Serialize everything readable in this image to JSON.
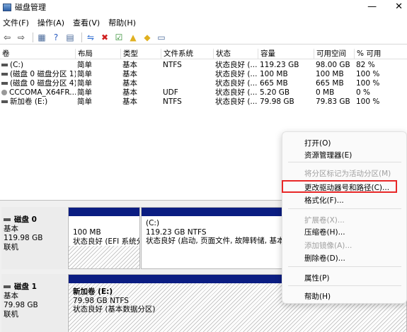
{
  "window": {
    "title": "磁盘管理",
    "minimize": "—",
    "close": "✕"
  },
  "menu": [
    "文件(F)",
    "操作(A)",
    "查看(V)",
    "帮助(H)"
  ],
  "toolbar": [
    {
      "name": "back-icon",
      "glyph": "⇦",
      "color": "#333333"
    },
    {
      "name": "forward-icon",
      "glyph": "⇨",
      "color": "#333333"
    },
    {
      "name": "sep"
    },
    {
      "name": "properties-icon",
      "glyph": "▦",
      "color": "#4a6a9a"
    },
    {
      "name": "help-icon",
      "glyph": "?",
      "color": "#2a5cc0"
    },
    {
      "name": "refresh-list-icon",
      "glyph": "▤",
      "color": "#4a6a9a"
    },
    {
      "name": "sep"
    },
    {
      "name": "connect-icon",
      "glyph": "⇋",
      "color": "#2a6ad0"
    },
    {
      "name": "delete-icon",
      "glyph": "✖",
      "color": "#d02020"
    },
    {
      "name": "check-icon",
      "glyph": "☑",
      "color": "#2a8a2a"
    },
    {
      "name": "folder-up-icon",
      "glyph": "▲",
      "color": "#e0b020"
    },
    {
      "name": "folder-find-icon",
      "glyph": "◆",
      "color": "#e0b020"
    },
    {
      "name": "view-icon",
      "glyph": "▭",
      "color": "#4a6a9a"
    }
  ],
  "volume_table": {
    "headers": [
      "卷",
      "布局",
      "类型",
      "文件系统",
      "状态",
      "容量",
      "可用空间",
      "% 可用"
    ],
    "rows": [
      {
        "icon": "volume-icon",
        "cells": [
          "(C:)",
          "简单",
          "基本",
          "NTFS",
          "状态良好 (...",
          "119.23 GB",
          "98.00 GB",
          "82 %"
        ]
      },
      {
        "icon": "volume-icon",
        "cells": [
          "(磁盘 0 磁盘分区 1)",
          "简单",
          "基本",
          "",
          "状态良好 (...",
          "100 MB",
          "100 MB",
          "100 %"
        ]
      },
      {
        "icon": "volume-icon",
        "cells": [
          "(磁盘 0 磁盘分区 4)",
          "简单",
          "基本",
          "",
          "状态良好 (...",
          "665 MB",
          "665 MB",
          "100 %"
        ]
      },
      {
        "icon": "cd-icon",
        "cells": [
          "CCCOMA_X64FR...",
          "简单",
          "基本",
          "UDF",
          "状态良好 (...",
          "5.20 GB",
          "0 MB",
          "0 %"
        ]
      },
      {
        "icon": "volume-icon",
        "cells": [
          "新加卷 (E:)",
          "简单",
          "基本",
          "NTFS",
          "状态良好 (...",
          "79.98 GB",
          "79.83 GB",
          "100 %"
        ]
      }
    ]
  },
  "disks": [
    {
      "name": "磁盘 0",
      "type": "基本",
      "size": "119.98 GB",
      "status": "联机",
      "partitions": [
        {
          "label": "",
          "lines": [
            "100 MB",
            "状态良好 (EFI 系统分区)"
          ]
        },
        {
          "label": "(C:)",
          "lines": [
            "119.23 GB NTFS",
            "状态良好 (启动, 页面文件, 故障转储, 基本数据分区)"
          ]
        }
      ]
    },
    {
      "name": "磁盘 1",
      "type": "基本",
      "size": "79.98 GB",
      "status": "联机",
      "partitions": [
        {
          "label": "新加卷  (E:)",
          "lines": [
            "79.98 GB NTFS",
            "状态良好 (基本数据分区)"
          ]
        }
      ]
    }
  ],
  "context_menu": {
    "items": [
      {
        "label": "打开(O)",
        "enabled": true
      },
      {
        "label": "资源管理器(E)",
        "enabled": true
      },
      {
        "sep": true
      },
      {
        "label": "将分区标记为活动分区(M)",
        "enabled": false
      },
      {
        "label": "更改驱动器号和路径(C)...",
        "enabled": true,
        "highlighted": true
      },
      {
        "label": "格式化(F)...",
        "enabled": true
      },
      {
        "sep": true
      },
      {
        "label": "扩展卷(X)...",
        "enabled": false
      },
      {
        "label": "压缩卷(H)...",
        "enabled": true
      },
      {
        "label": "添加镜像(A)...",
        "enabled": false
      },
      {
        "label": "删除卷(D)...",
        "enabled": true
      },
      {
        "sep": true
      },
      {
        "label": "属性(P)",
        "enabled": true
      },
      {
        "sep": true
      },
      {
        "label": "帮助(H)",
        "enabled": true
      }
    ]
  },
  "colors": {
    "partition_bar": "#0b1d82",
    "highlight_border": "#e82727"
  }
}
